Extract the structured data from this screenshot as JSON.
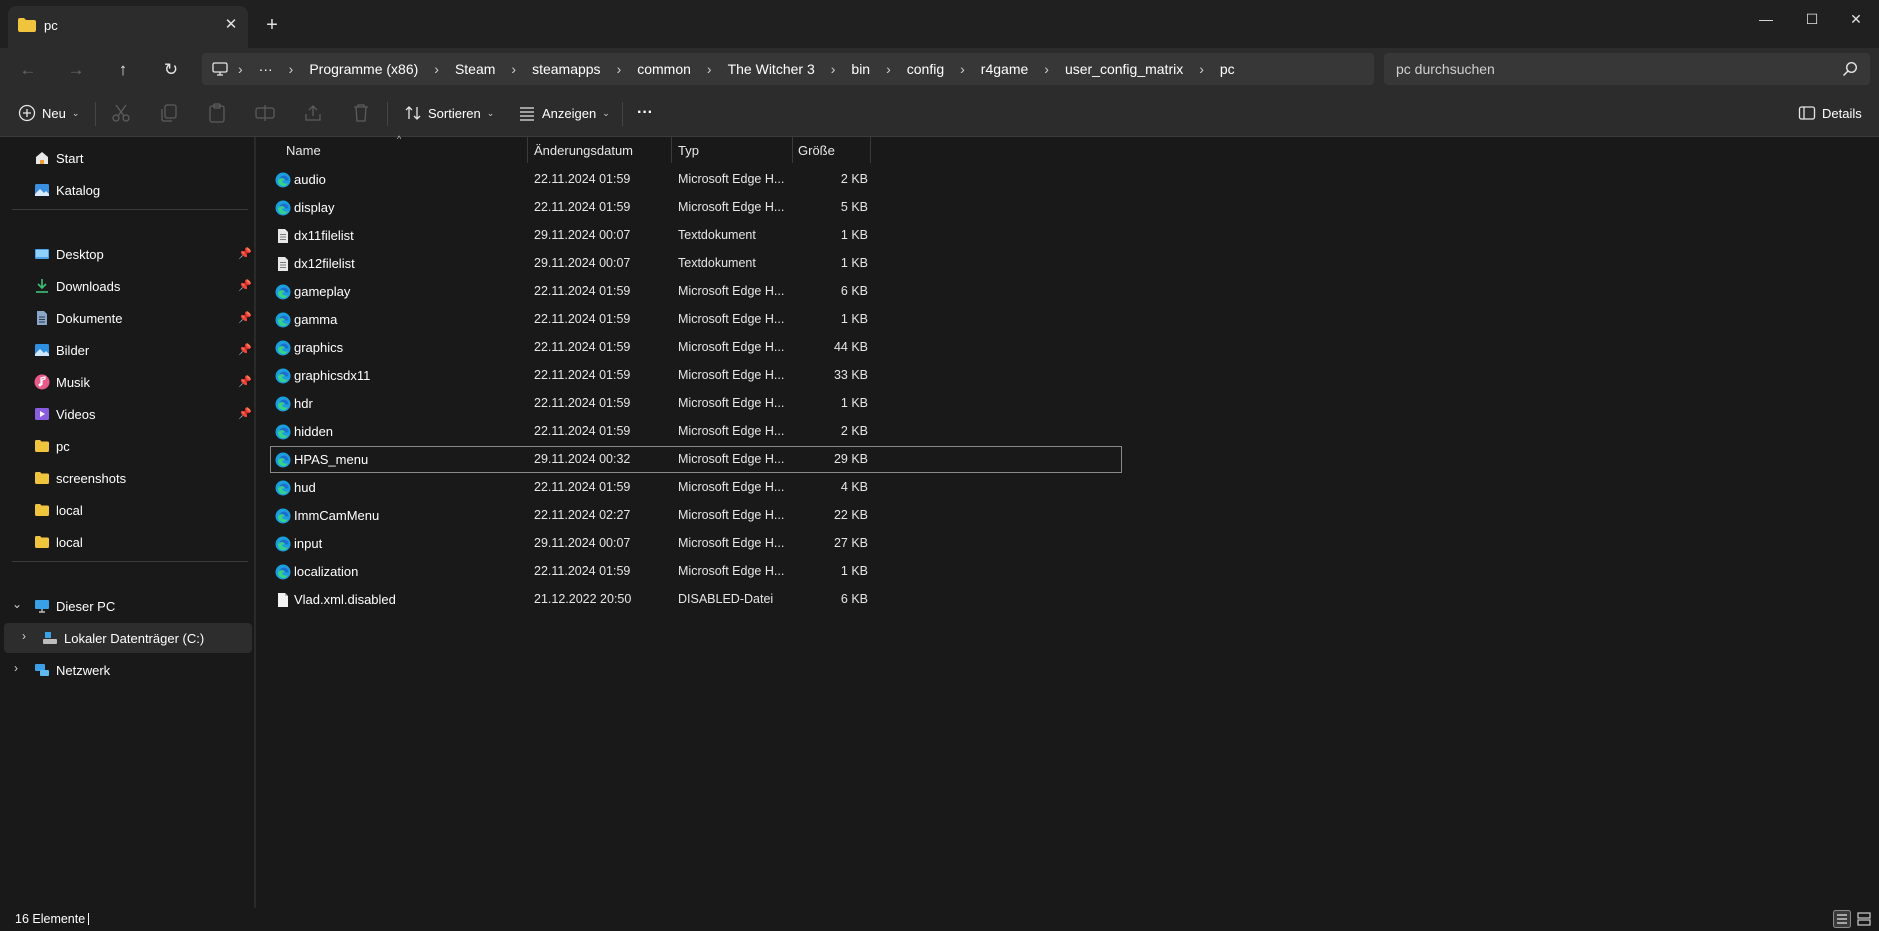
{
  "window": {
    "tab_title": "pc",
    "new_tab_label": "+",
    "close_tab_label": "✕",
    "minimize_label": "—",
    "maximize_label": "☐",
    "close_label": "✕"
  },
  "address": {
    "more_label": "···",
    "breadcrumbs": [
      "Programme (x86)",
      "Steam",
      "steamapps",
      "common",
      "The Witcher 3",
      "bin",
      "config",
      "r4game",
      "user_config_matrix",
      "pc"
    ],
    "search_placeholder": "pc durchsuchen"
  },
  "toolbar": {
    "new_label": "Neu",
    "sort_label": "Sortieren",
    "view_label": "Anzeigen",
    "more_label": "···",
    "details_label": "Details"
  },
  "sidebar": {
    "top": [
      {
        "label": "Start",
        "icon": "home-icon"
      },
      {
        "label": "Katalog",
        "icon": "gallery-icon"
      }
    ],
    "pinned": [
      {
        "label": "Desktop",
        "icon": "desktop-icon"
      },
      {
        "label": "Downloads",
        "icon": "download-icon"
      },
      {
        "label": "Dokumente",
        "icon": "document-icon"
      },
      {
        "label": "Bilder",
        "icon": "pictures-icon"
      },
      {
        "label": "Musik",
        "icon": "music-icon"
      },
      {
        "label": "Videos",
        "icon": "videos-icon"
      }
    ],
    "folders": [
      {
        "label": "pc"
      },
      {
        "label": "screenshots"
      },
      {
        "label": "local"
      },
      {
        "label": "local"
      }
    ],
    "this_pc": "Dieser PC",
    "drive": "Lokaler Datenträger (C:)",
    "network": "Netzwerk"
  },
  "columns": {
    "name": "Name",
    "date": "Änderungsdatum",
    "type": "Typ",
    "size": "Größe"
  },
  "files": [
    {
      "name": "audio",
      "date": "22.11.2024 01:59",
      "type": "Microsoft Edge H...",
      "size": "2 KB",
      "icon": "edge-icon"
    },
    {
      "name": "display",
      "date": "22.11.2024 01:59",
      "type": "Microsoft Edge H...",
      "size": "5 KB",
      "icon": "edge-icon"
    },
    {
      "name": "dx11filelist",
      "date": "29.11.2024 00:07",
      "type": "Textdokument",
      "size": "1 KB",
      "icon": "text-file-icon"
    },
    {
      "name": "dx12filelist",
      "date": "29.11.2024 00:07",
      "type": "Textdokument",
      "size": "1 KB",
      "icon": "text-file-icon"
    },
    {
      "name": "gameplay",
      "date": "22.11.2024 01:59",
      "type": "Microsoft Edge H...",
      "size": "6 KB",
      "icon": "edge-icon"
    },
    {
      "name": "gamma",
      "date": "22.11.2024 01:59",
      "type": "Microsoft Edge H...",
      "size": "1 KB",
      "icon": "edge-icon"
    },
    {
      "name": "graphics",
      "date": "22.11.2024 01:59",
      "type": "Microsoft Edge H...",
      "size": "44 KB",
      "icon": "edge-icon"
    },
    {
      "name": "graphicsdx11",
      "date": "22.11.2024 01:59",
      "type": "Microsoft Edge H...",
      "size": "33 KB",
      "icon": "edge-icon"
    },
    {
      "name": "hdr",
      "date": "22.11.2024 01:59",
      "type": "Microsoft Edge H...",
      "size": "1 KB",
      "icon": "edge-icon"
    },
    {
      "name": "hidden",
      "date": "22.11.2024 01:59",
      "type": "Microsoft Edge H...",
      "size": "2 KB",
      "icon": "edge-icon"
    },
    {
      "name": "HPAS_menu",
      "date": "29.11.2024 00:32",
      "type": "Microsoft Edge H...",
      "size": "29 KB",
      "icon": "edge-icon",
      "selected": true
    },
    {
      "name": "hud",
      "date": "22.11.2024 01:59",
      "type": "Microsoft Edge H...",
      "size": "4 KB",
      "icon": "edge-icon"
    },
    {
      "name": "ImmCamMenu",
      "date": "22.11.2024 02:27",
      "type": "Microsoft Edge H...",
      "size": "22 KB",
      "icon": "edge-icon"
    },
    {
      "name": "input",
      "date": "29.11.2024 00:07",
      "type": "Microsoft Edge H...",
      "size": "27 KB",
      "icon": "edge-icon"
    },
    {
      "name": "localization",
      "date": "22.11.2024 01:59",
      "type": "Microsoft Edge H...",
      "size": "1 KB",
      "icon": "edge-icon"
    },
    {
      "name": "Vlad.xml.disabled",
      "date": "21.12.2022 20:50",
      "type": "DISABLED-Datei",
      "size": "6 KB",
      "icon": "blank-file-icon"
    }
  ],
  "status": {
    "count": "16 Elemente"
  },
  "colors": {
    "background": "#191919",
    "chrome": "#2c2c2c",
    "folder": "#f0c43c",
    "edge": "#1b9de2"
  }
}
